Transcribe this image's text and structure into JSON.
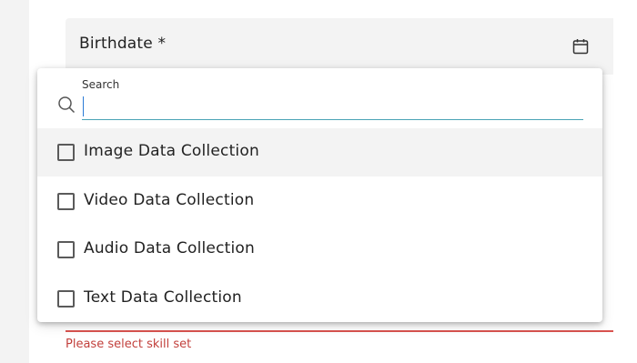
{
  "birthdate_field": {
    "label": "Birthdate *",
    "icon": "calendar-icon"
  },
  "skill_dropdown": {
    "search": {
      "label": "Search",
      "value": "",
      "icon": "search-icon"
    },
    "options": [
      {
        "label": "Image Data Collection",
        "checked": false,
        "highlighted": true
      },
      {
        "label": "Video Data Collection",
        "checked": false,
        "highlighted": false
      },
      {
        "label": "Audio Data Collection",
        "checked": false,
        "highlighted": false
      },
      {
        "label": "Text Data Collection",
        "checked": false,
        "highlighted": false
      }
    ]
  },
  "skill_field": {
    "error": "Please select skill set",
    "error_color": "#c2403c"
  },
  "colors": {
    "field_background": "#f3f3f3",
    "focus_underline": "#4aa3b5",
    "error_underline": "#d9534f"
  }
}
